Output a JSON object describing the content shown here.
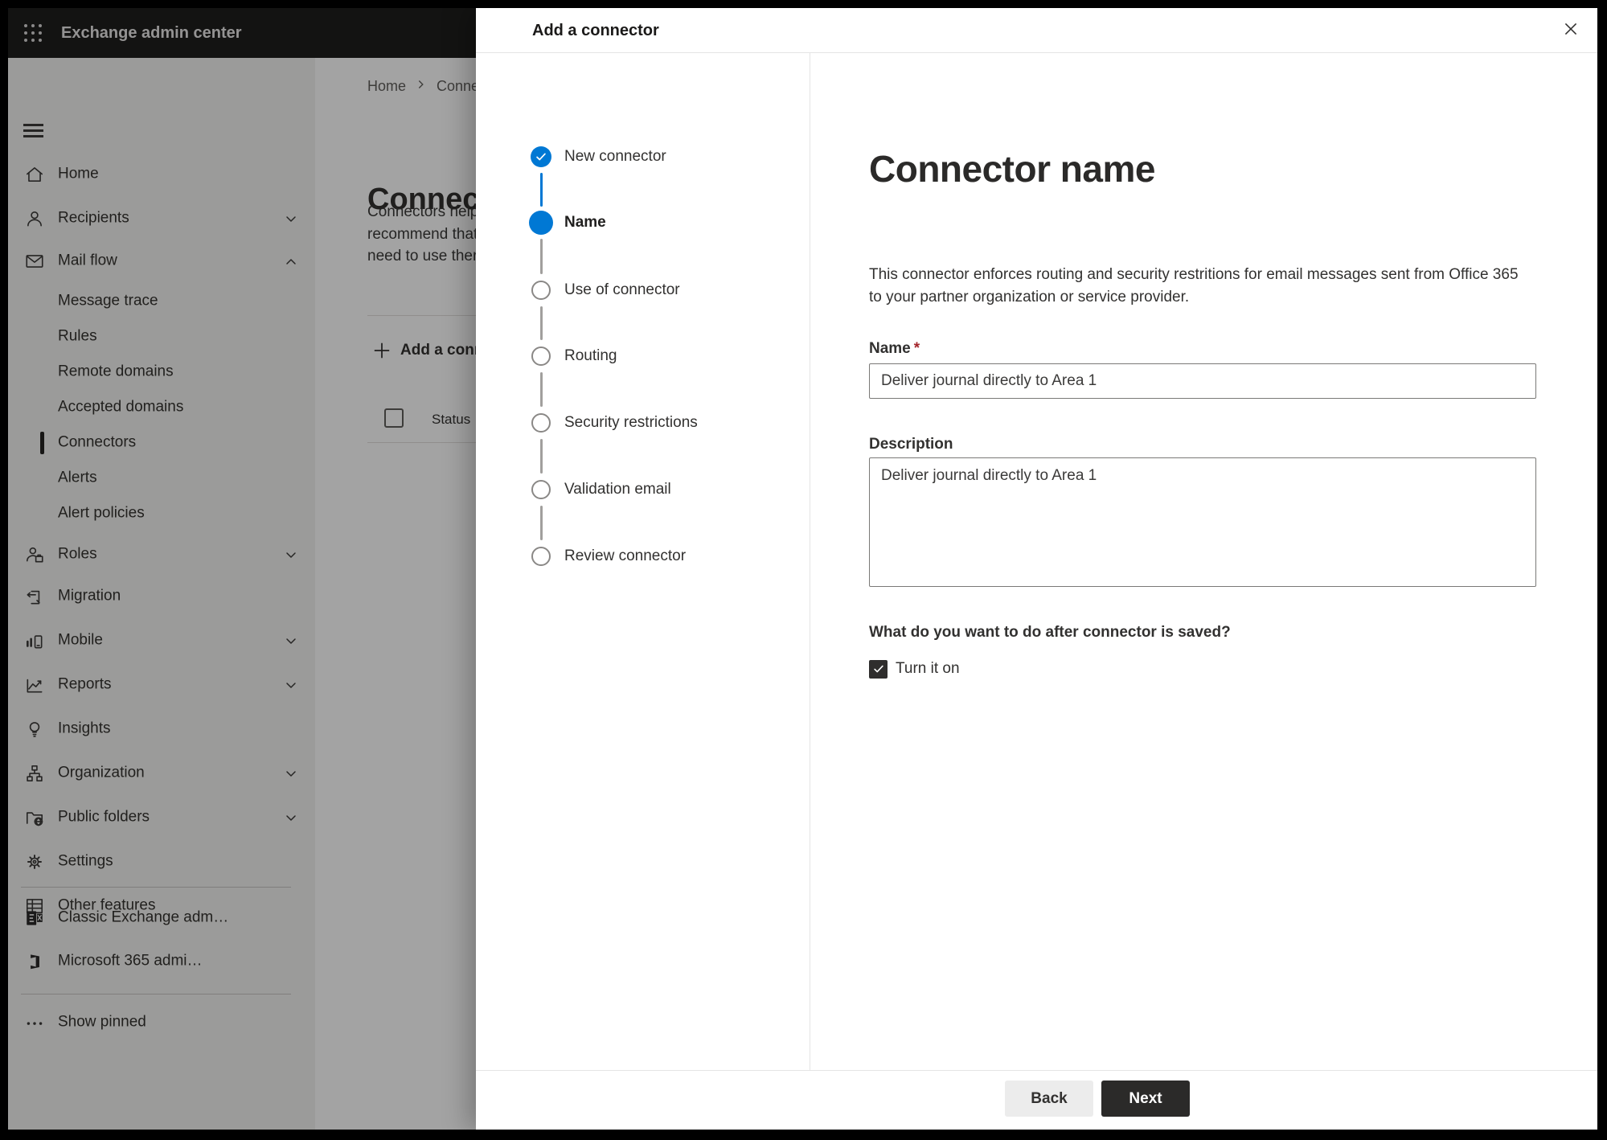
{
  "topbar": {
    "title": "Exchange admin center"
  },
  "sidebar": {
    "items": [
      {
        "label": "Home"
      },
      {
        "label": "Recipients"
      },
      {
        "label": "Mail flow"
      },
      {
        "label": "Message trace"
      },
      {
        "label": "Rules"
      },
      {
        "label": "Remote domains"
      },
      {
        "label": "Accepted domains"
      },
      {
        "label": "Connectors",
        "selected": true
      },
      {
        "label": "Alerts"
      },
      {
        "label": "Alert policies"
      },
      {
        "label": "Roles"
      },
      {
        "label": "Migration"
      },
      {
        "label": "Mobile"
      },
      {
        "label": "Reports"
      },
      {
        "label": "Insights"
      },
      {
        "label": "Organization"
      },
      {
        "label": "Public folders"
      },
      {
        "label": "Settings"
      },
      {
        "label": "Other features"
      }
    ],
    "footer_items": [
      {
        "label": "Classic Exchange adm…"
      },
      {
        "label": "Microsoft 365 admi…"
      },
      {
        "label": "Show pinned"
      }
    ]
  },
  "background_page": {
    "breadcrumb": {
      "home": "Home",
      "current": "Conne"
    },
    "page_title": "Connect",
    "intro_lines": [
      "Connectors help",
      "recommend that",
      "need to use ther"
    ],
    "add_connector_button": "Add a conn",
    "table": {
      "status_header": "Status"
    }
  },
  "dialog": {
    "title": "Add a connector",
    "steps": [
      {
        "label": "New connector",
        "state": "completed"
      },
      {
        "label": "Name",
        "state": "current"
      },
      {
        "label": "Use of connector",
        "state": "upcoming"
      },
      {
        "label": "Routing",
        "state": "upcoming"
      },
      {
        "label": "Security restrictions",
        "state": "upcoming"
      },
      {
        "label": "Validation email",
        "state": "upcoming"
      },
      {
        "label": "Review connector",
        "state": "upcoming"
      }
    ],
    "heading": "Connector name",
    "description_line1": "This connector enforces routing and security restritions for email messages sent from Office 365",
    "description_line2": "to your partner organization or service provider.",
    "name_field": {
      "label": "Name",
      "required_mark": "*",
      "value": "Deliver journal directly to Area 1"
    },
    "description_field": {
      "label": "Description",
      "value": "Deliver journal directly to Area 1"
    },
    "after_save_question": "What do you want to do after connector is saved?",
    "turn_it_on": {
      "label": "Turn it on",
      "checked": true
    },
    "footer": {
      "back_label": "Back",
      "next_label": "Next"
    }
  },
  "colors": {
    "accent": "#0078d4",
    "required": "#a4262c",
    "next_button": "#2b2a29"
  }
}
